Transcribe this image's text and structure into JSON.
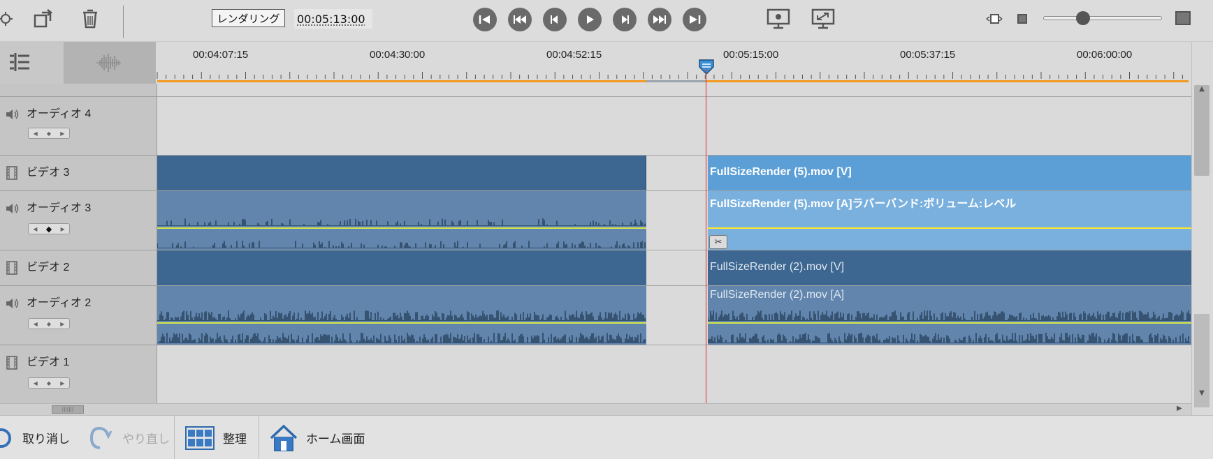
{
  "toolbar": {
    "render_label": "レンダリング",
    "timecode": "00:05:13:00"
  },
  "ruler": {
    "time_labels": [
      "00:04:07:15",
      "00:04:30:00",
      "00:04:52:15",
      "00:05:15:00",
      "00:05:37:15",
      "00:06:00:00"
    ]
  },
  "tracks": [
    {
      "name": "オーディオ 4",
      "type": "audio"
    },
    {
      "name": "ビデオ 3",
      "type": "video"
    },
    {
      "name": "オーディオ 3",
      "type": "audio"
    },
    {
      "name": "ビデオ 2",
      "type": "video"
    },
    {
      "name": "オーディオ 2",
      "type": "audio"
    },
    {
      "name": "ビデオ 1",
      "type": "video"
    }
  ],
  "clips": {
    "video3_right": "FullSizeRender (5).mov [V]",
    "audio3_right": "FullSizeRender (5).mov [A]ラバーバンド:ボリューム:レベル",
    "video2_right": "FullSizeRender (2).mov [V]",
    "audio2_right": "FullSizeRender (2).mov [A]"
  },
  "bottom": {
    "undo_label": "取り消し",
    "redo_label": "やり直し",
    "organize_label": "整理",
    "home_label": "ホーム画面"
  },
  "colors": {
    "video_clip": "#3d6791",
    "audio_clip": "#6285ad",
    "selected_video_clip": "#5b9fd6",
    "selected_audio_clip": "#79b0dd",
    "playhead": "#e02a2a",
    "work_area": "#f29a1e"
  }
}
